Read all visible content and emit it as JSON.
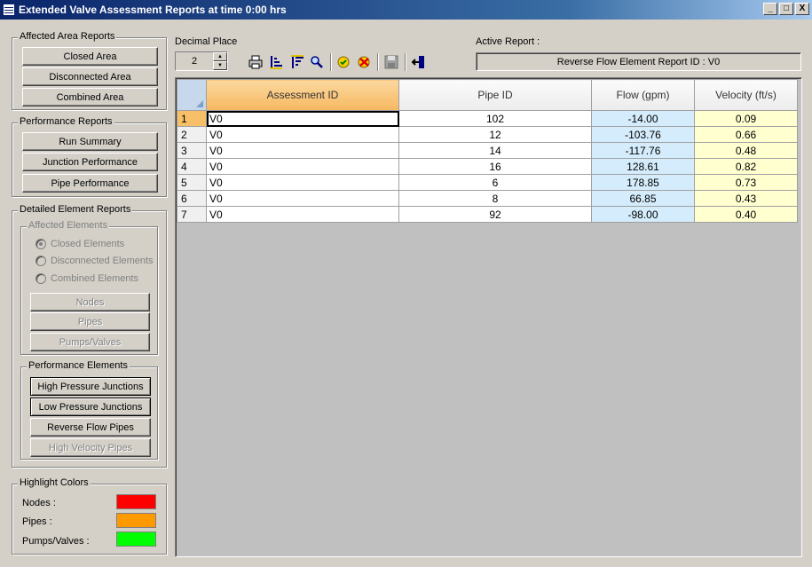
{
  "window": {
    "title": "Extended Valve Assessment Reports at time 0:00 hrs",
    "minimize": "_",
    "maximize": "□",
    "close": "X"
  },
  "affected_area": {
    "legend": "Affected Area Reports",
    "buttons": [
      "Closed Area",
      "Disconnected Area",
      "Combined Area"
    ]
  },
  "performance": {
    "legend": "Performance Reports",
    "buttons": [
      "Run Summary",
      "Junction Performance",
      "Pipe Performance"
    ]
  },
  "detailed": {
    "legend": "Detailed Element Reports",
    "affected": {
      "legend": "Affected Elements",
      "radios": [
        "Closed Elements",
        "Disconnected Elements",
        "Combined Elements"
      ],
      "selected_radio": "Closed Elements",
      "buttons": [
        "Nodes",
        "Pipes",
        "Pumps/Valves"
      ]
    },
    "perf_elements": {
      "legend": "Performance Elements",
      "buttons": [
        "High Pressure Junctions",
        "Low Pressure Junctions",
        "Reverse Flow Pipes",
        "High Velocity Pipes"
      ]
    }
  },
  "highlight": {
    "legend": "Highlight Colors",
    "items": [
      {
        "label": "Nodes :",
        "color": "#ff0000"
      },
      {
        "label": "Pipes :",
        "color": "#ff9900"
      },
      {
        "label": "Pumps/Valves :",
        "color": "#00ff00"
      }
    ]
  },
  "toolbar": {
    "decimal_label": "Decimal Place",
    "decimal_value": "2",
    "active_label": "Active Report :",
    "active_value": "Reverse Flow Element Report ID :  V0",
    "icons": [
      "print-icon",
      "sort-ascending-icon",
      "sort-descending-icon",
      "find-icon",
      "highlight-icon",
      "clear-highlight-icon",
      "save-icon",
      "exit-icon"
    ]
  },
  "grid": {
    "columns": [
      "Assessment ID",
      "Pipe ID",
      "Flow (gpm)",
      "Velocity (ft/s)"
    ],
    "rows": [
      {
        "n": "1",
        "aid": "V0",
        "pipe": "102",
        "flow": "-14.00",
        "vel": "0.09"
      },
      {
        "n": "2",
        "aid": "V0",
        "pipe": "12",
        "flow": "-103.76",
        "vel": "0.66"
      },
      {
        "n": "3",
        "aid": "V0",
        "pipe": "14",
        "flow": "-117.76",
        "vel": "0.48"
      },
      {
        "n": "4",
        "aid": "V0",
        "pipe": "16",
        "flow": "128.61",
        "vel": "0.82"
      },
      {
        "n": "5",
        "aid": "V0",
        "pipe": "6",
        "flow": "178.85",
        "vel": "0.73"
      },
      {
        "n": "6",
        "aid": "V0",
        "pipe": "8",
        "flow": "66.85",
        "vel": "0.43"
      },
      {
        "n": "7",
        "aid": "V0",
        "pipe": "92",
        "flow": "-98.00",
        "vel": "0.40"
      }
    ]
  }
}
